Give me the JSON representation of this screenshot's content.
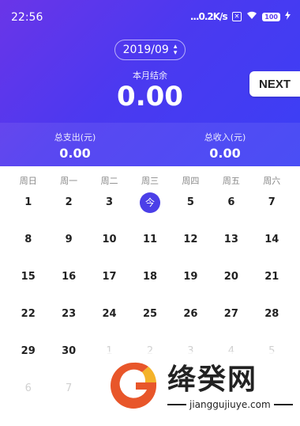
{
  "status_bar": {
    "time": "22:56",
    "network_speed": "...0.2K/s",
    "sim_badge": "✕",
    "battery": "100"
  },
  "header": {
    "month": "2019/09",
    "balance_label": "本月结余",
    "balance_value": "0.00",
    "next_label": "NEXT"
  },
  "summary": {
    "expense_label": "总支出(元)",
    "expense_value": "0.00",
    "income_label": "总收入(元)",
    "income_value": "0.00"
  },
  "calendar": {
    "weekdays": [
      "周日",
      "周一",
      "周二",
      "周三",
      "周四",
      "周五",
      "周六"
    ],
    "today_label": "今",
    "days": [
      {
        "d": "1",
        "f": false
      },
      {
        "d": "2",
        "f": false
      },
      {
        "d": "3",
        "f": false
      },
      {
        "d": "今",
        "f": false,
        "today": true
      },
      {
        "d": "5",
        "f": false
      },
      {
        "d": "6",
        "f": false
      },
      {
        "d": "7",
        "f": false
      },
      {
        "d": "8",
        "f": false
      },
      {
        "d": "9",
        "f": false
      },
      {
        "d": "10",
        "f": false
      },
      {
        "d": "11",
        "f": false
      },
      {
        "d": "12",
        "f": false
      },
      {
        "d": "13",
        "f": false
      },
      {
        "d": "14",
        "f": false
      },
      {
        "d": "15",
        "f": false
      },
      {
        "d": "16",
        "f": false
      },
      {
        "d": "17",
        "f": false
      },
      {
        "d": "18",
        "f": false
      },
      {
        "d": "19",
        "f": false
      },
      {
        "d": "20",
        "f": false
      },
      {
        "d": "21",
        "f": false
      },
      {
        "d": "22",
        "f": false
      },
      {
        "d": "23",
        "f": false
      },
      {
        "d": "24",
        "f": false
      },
      {
        "d": "25",
        "f": false
      },
      {
        "d": "26",
        "f": false
      },
      {
        "d": "27",
        "f": false
      },
      {
        "d": "28",
        "f": false
      },
      {
        "d": "29",
        "f": false
      },
      {
        "d": "30",
        "f": false
      },
      {
        "d": "1",
        "f": true
      },
      {
        "d": "2",
        "f": true
      },
      {
        "d": "3",
        "f": true
      },
      {
        "d": "4",
        "f": true
      },
      {
        "d": "5",
        "f": true
      },
      {
        "d": "6",
        "f": true
      },
      {
        "d": "7",
        "f": true
      }
    ]
  },
  "watermark": {
    "name": "绛癸网",
    "url": "jianggujiuye.com"
  },
  "colors": {
    "accent": "#4b3fe8",
    "header_start": "#6a35e8",
    "header_end": "#3b3ff5"
  }
}
